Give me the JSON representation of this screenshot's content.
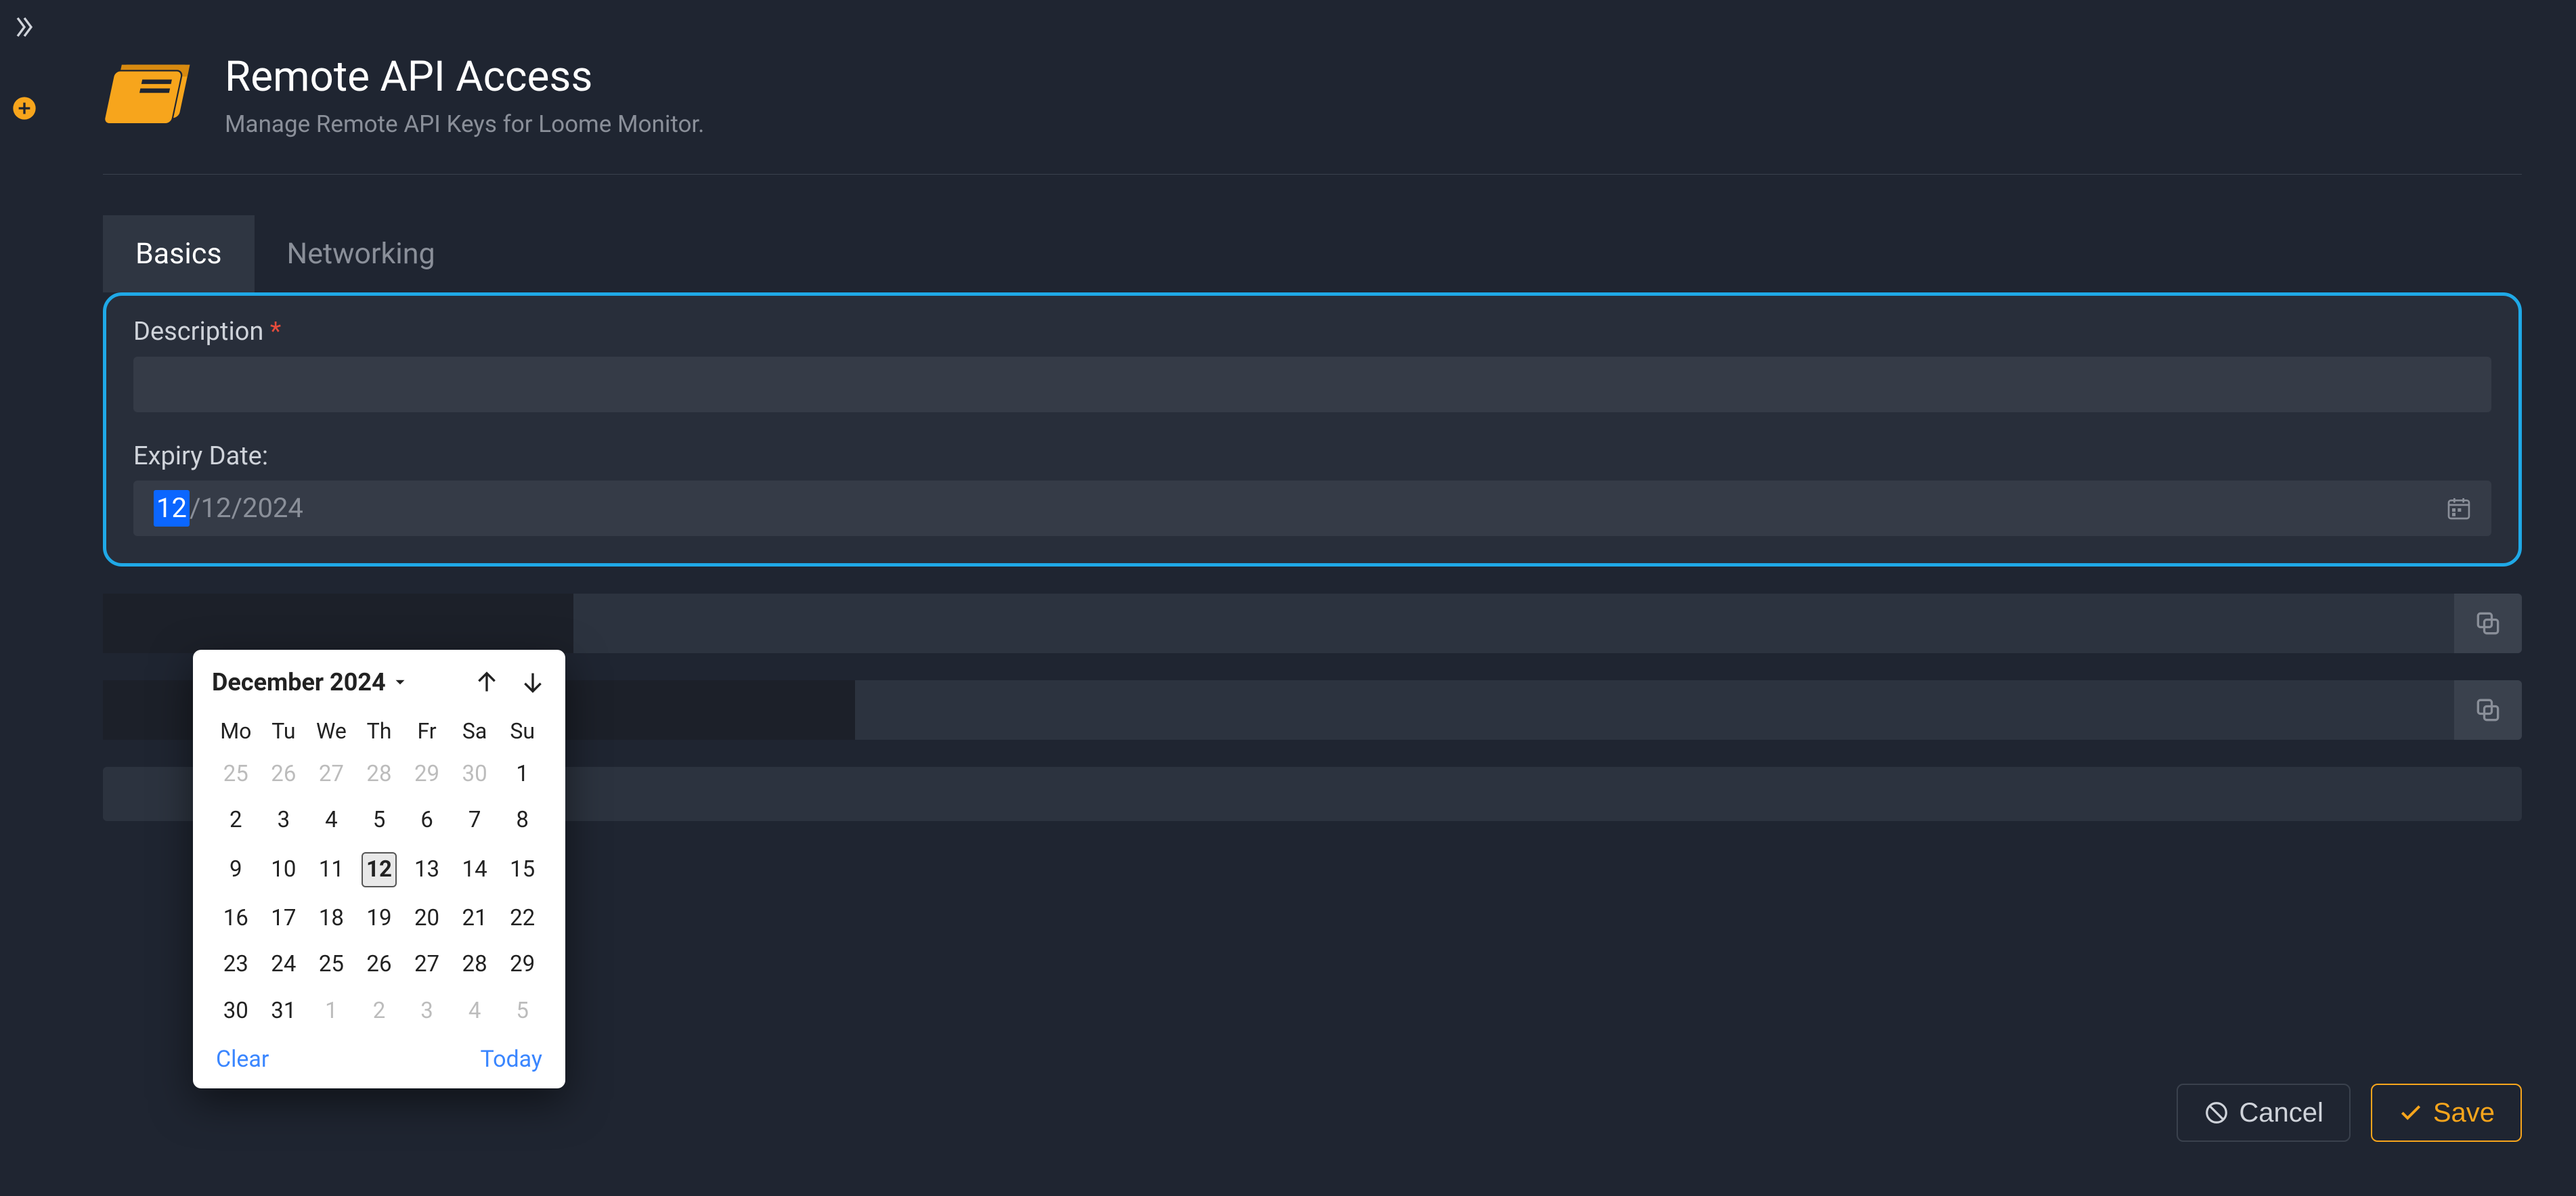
{
  "page": {
    "title": "Remote API Access",
    "subtitle": "Manage Remote API Keys for Loome Monitor."
  },
  "tabs": {
    "basics": "Basics",
    "networking": "Networking",
    "active": "basics"
  },
  "form": {
    "description_label": "Description",
    "description_value": "",
    "expiry_label": "Expiry Date:",
    "expiry_parts": {
      "day": "12",
      "sep1": "/",
      "month": "12",
      "sep2": "/",
      "year": "2024"
    }
  },
  "calendar": {
    "month_label": "December 2024",
    "weekdays": [
      "Mo",
      "Tu",
      "We",
      "Th",
      "Fr",
      "Sa",
      "Su"
    ],
    "grid": [
      [
        {
          "n": 25,
          "o": true
        },
        {
          "n": 26,
          "o": true
        },
        {
          "n": 27,
          "o": true
        },
        {
          "n": 28,
          "o": true
        },
        {
          "n": 29,
          "o": true
        },
        {
          "n": 30,
          "o": true
        },
        {
          "n": 1
        }
      ],
      [
        {
          "n": 2
        },
        {
          "n": 3
        },
        {
          "n": 4
        },
        {
          "n": 5
        },
        {
          "n": 6
        },
        {
          "n": 7
        },
        {
          "n": 8
        }
      ],
      [
        {
          "n": 9
        },
        {
          "n": 10
        },
        {
          "n": 11
        },
        {
          "n": 12,
          "sel": true
        },
        {
          "n": 13
        },
        {
          "n": 14
        },
        {
          "n": 15
        }
      ],
      [
        {
          "n": 16
        },
        {
          "n": 17
        },
        {
          "n": 18
        },
        {
          "n": 19
        },
        {
          "n": 20
        },
        {
          "n": 21
        },
        {
          "n": 22
        }
      ],
      [
        {
          "n": 23
        },
        {
          "n": 24
        },
        {
          "n": 25
        },
        {
          "n": 26
        },
        {
          "n": 27
        },
        {
          "n": 28
        },
        {
          "n": 29
        }
      ],
      [
        {
          "n": 30
        },
        {
          "n": 31
        },
        {
          "n": 1,
          "o": true
        },
        {
          "n": 2,
          "o": true
        },
        {
          "n": 3,
          "o": true
        },
        {
          "n": 4,
          "o": true
        },
        {
          "n": 5,
          "o": true
        }
      ]
    ],
    "clear_label": "Clear",
    "today_label": "Today"
  },
  "locked_rows": [
    {
      "mask_width_pct": 20
    },
    {
      "mask_width_pct": 32
    }
  ],
  "footer": {
    "cancel_label": "Cancel",
    "save_label": "Save"
  }
}
